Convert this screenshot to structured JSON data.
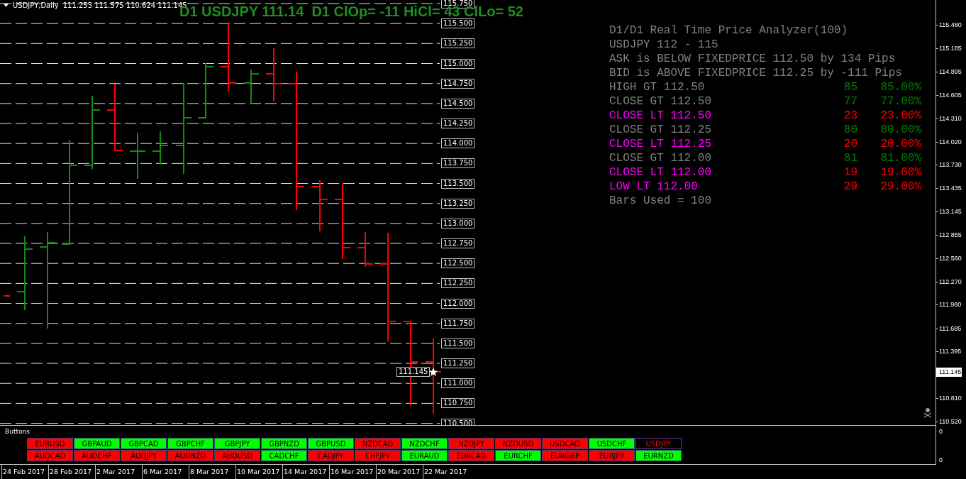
{
  "chart_header": {
    "symbol": "USDJPY,Daily",
    "ohlc": "111.253 111.575 110.624 111.145"
  },
  "headline": "D1 USDJPY 111.14  D1 ClOp= -11 HiCl= 43 ClLo= 52",
  "levels": [
    "115.750",
    "115.500",
    "115.250",
    "115.000",
    "114.750",
    "114.500",
    "114.250",
    "114.000",
    "113.750",
    "113.500",
    "113.250",
    "113.000",
    "112.750",
    "112.500",
    "112.250",
    "112.000",
    "111.750",
    "111.500",
    "111.250",
    "111.000",
    "110.750",
    "110.500"
  ],
  "current_price_label": "111.145",
  "analyzer": {
    "lines": [
      "D1/D1 Real Time Price Analyzer(100)",
      "USDJPY 112 - 115",
      "ASK is BELOW FIXEDPRICE 112.50 by 134 Pips",
      "BID is ABOVE FIXEDPRICE 112.25 by -111 Pips"
    ],
    "rows": [
      {
        "kind": "gt",
        "label": "HIGH GT 112.50",
        "count": "85",
        "percent": "85.00%"
      },
      {
        "kind": "gt",
        "label": "CLOSE GT 112.50",
        "count": "77",
        "percent": "77.00%"
      },
      {
        "kind": "lt",
        "label": "CLOSE LT 112.50",
        "count": "23",
        "percent": "23.00%"
      },
      {
        "kind": "gt",
        "label": "CLOSE GT 112.25",
        "count": "80",
        "percent": "80.00%"
      },
      {
        "kind": "lt",
        "label": "CLOSE LT 112.25",
        "count": "20",
        "percent": "20.00%"
      },
      {
        "kind": "gt",
        "label": "CLOSE GT 112.00",
        "count": "81",
        "percent": "81.00%"
      },
      {
        "kind": "lt",
        "label": "CLOSE LT 112.00",
        "count": "19",
        "percent": "19.00%"
      },
      {
        "kind": "lt",
        "label": "LOW LT 112.00",
        "count": "29",
        "percent": "29.00%"
      }
    ],
    "footer": "Bars Used = 100"
  },
  "price_axis": [
    "115.480",
    "115.185",
    "114.895",
    "114.605",
    "114.310",
    "114.020",
    "113.730",
    "113.435",
    "113.145",
    "112.855",
    "112.560",
    "112.270",
    "111.980",
    "111.685",
    "111.395",
    "110.810",
    "110.520"
  ],
  "price_axis_current": "111.145",
  "buttons_panel": {
    "title": "Buttons",
    "axis": [
      "0",
      "0"
    ],
    "buttons": [
      [
        {
          "label": "EURUSD",
          "color": "#ff0000",
          "selected": false
        },
        {
          "label": "GBPAUD",
          "color": "#00ff00",
          "selected": false
        },
        {
          "label": "GBPCAD",
          "color": "#00ff00",
          "selected": false
        },
        {
          "label": "GBPCHF",
          "color": "#00ff00",
          "selected": false
        },
        {
          "label": "GBPJPY",
          "color": "#00ff00",
          "selected": false
        },
        {
          "label": "GBPNZD",
          "color": "#00ff00",
          "selected": false
        },
        {
          "label": "GBPUSD",
          "color": "#00ff00",
          "selected": false
        },
        {
          "label": "NZDCAD",
          "color": "#ff0000",
          "selected": false
        },
        {
          "label": "NZDCHF",
          "color": "#00ff00",
          "selected": false
        },
        {
          "label": "NZDJPY",
          "color": "#ff0000",
          "selected": false
        },
        {
          "label": "NZDUSD",
          "color": "#ff0000",
          "selected": false
        },
        {
          "label": "USDCAD",
          "color": "#ff0000",
          "selected": false
        },
        {
          "label": "USDCHF",
          "color": "#00ff00",
          "selected": false
        },
        {
          "label": "USDJPY",
          "color": "#ff0000",
          "selected": true
        }
      ],
      [
        {
          "label": "AUDCAD",
          "color": "#ff0000",
          "selected": false
        },
        {
          "label": "AUDCHF",
          "color": "#ff0000",
          "selected": false
        },
        {
          "label": "AUDJPY",
          "color": "#ff0000",
          "selected": false
        },
        {
          "label": "AUDNZD",
          "color": "#ff0000",
          "selected": false
        },
        {
          "label": "AUDUSD",
          "color": "#ff0000",
          "selected": false
        },
        {
          "label": "CADCHF",
          "color": "#00ff00",
          "selected": false
        },
        {
          "label": "CADJPY",
          "color": "#ff0000",
          "selected": false
        },
        {
          "label": "CHFJPY",
          "color": "#ff0000",
          "selected": false
        },
        {
          "label": "EURAUD",
          "color": "#00ff00",
          "selected": false
        },
        {
          "label": "EURCAD",
          "color": "#ff0000",
          "selected": false
        },
        {
          "label": "EURCHF",
          "color": "#00ff00",
          "selected": false
        },
        {
          "label": "EURGBP",
          "color": "#ff0000",
          "selected": false
        },
        {
          "label": "EURJPY",
          "color": "#ff0000",
          "selected": false
        },
        {
          "label": "EURNZD",
          "color": "#00ff00",
          "selected": false
        }
      ]
    ]
  },
  "time_axis": [
    "24 Feb 2017",
    "28 Feb 2017",
    "2 Mar 2017",
    "6 Mar 2017",
    "8 Mar 2017",
    "10 Mar 2017",
    "14 Mar 2017",
    "16 Mar 2017",
    "20 Mar 2017",
    "22 Mar 2017"
  ]
}
